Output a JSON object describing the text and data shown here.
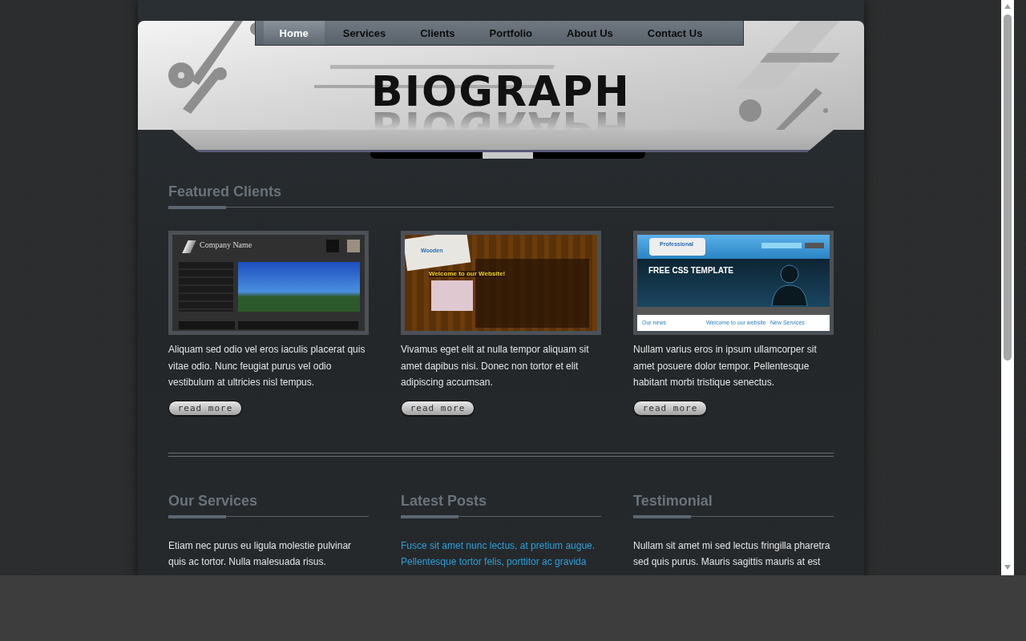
{
  "nav": [
    {
      "label": "Home",
      "selected": true
    },
    {
      "label": "Services",
      "selected": false
    },
    {
      "label": "Clients",
      "selected": false
    },
    {
      "label": "Portfolio",
      "selected": false
    },
    {
      "label": "About Us",
      "selected": false
    },
    {
      "label": "Contact Us",
      "selected": false
    }
  ],
  "logo": "BIOGRAPH",
  "featured": {
    "title": "Featured Clients",
    "clients": [
      {
        "thumbnail": {
          "kind": "company",
          "title": "Company Name"
        },
        "text": "Aliquam sed odio vel eros iaculis placerat quis vitae odio. Nunc feugiat purus vel odio vestibulum at ultricies nisl tempus.",
        "button": "read more"
      },
      {
        "thumbnail": {
          "kind": "wooden",
          "title": "Wooden",
          "heading": "Welcome to our Website!"
        },
        "text": "Vivamus eget elit at nulla tempor aliquam sit amet dapibus nisi. Donec non tortor et elit adipiscing accumsan.",
        "button": "read more"
      },
      {
        "thumbnail": {
          "kind": "professional",
          "title": "Professional",
          "heading": "FREE CSS TEMPLATE",
          "columns": [
            "Our news",
            "Welcome to our website",
            "New Services"
          ]
        },
        "text": "Nullam varius eros in ipsum ullamcorper sit amet posuere dolor tempor. Pellentesque habitant morbi tristique senectus.",
        "button": "read more"
      }
    ]
  },
  "sections": [
    {
      "title": "Our Services",
      "kind": "text",
      "text": "Etiam nec purus eu ligula molestie pulvinar quis ac tortor. Nulla malesuada risus."
    },
    {
      "title": "Latest Posts",
      "kind": "link",
      "text": "Fusce sit amet nunc lectus, at pretium augue. Pellentesque tortor felis, porttitor ac gravida"
    },
    {
      "title": "Testimonial",
      "kind": "text",
      "text": "Nullam sit amet mi sed lectus fringilla pharetra sed quis purus. Mauris sagittis mauris at est"
    }
  ]
}
